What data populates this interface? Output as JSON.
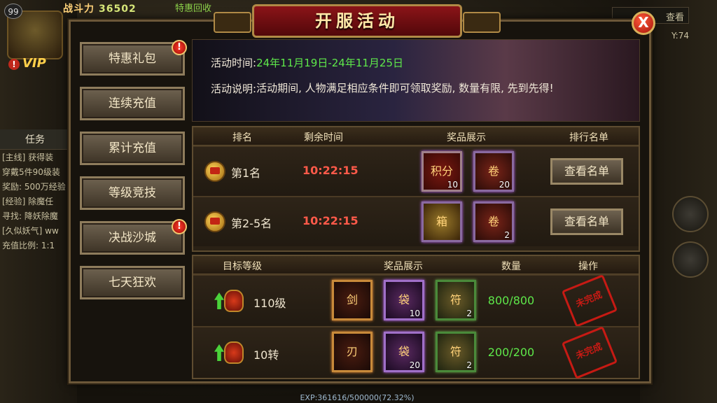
{
  "hud": {
    "level": "99",
    "power_label": "战斗力",
    "power_value": "36502",
    "power_extra": "特惠回收",
    "vip": "VIP",
    "alert_mark": "!",
    "map_title": "查看",
    "coord": "Y:74",
    "exp": "EXP:361616/500000(72.32%)",
    "quest": {
      "title": "任务",
      "lines": [
        "[主线] 获得装",
        "穿戴5件90级装",
        "奖励: 500万经验",
        "[经验] 除魔任",
        "寻找: 降妖除魔",
        "[久似妖气] ww",
        "充值比例: 1:1"
      ]
    }
  },
  "panel": {
    "title": "开服活动",
    "close_label": "X",
    "tabs": [
      {
        "label": "特惠礼包",
        "alert": "!"
      },
      {
        "label": "连续充值",
        "alert": ""
      },
      {
        "label": "累计充值",
        "alert": ""
      },
      {
        "label": "等级竞技",
        "alert": ""
      },
      {
        "label": "决战沙城",
        "alert": "!"
      },
      {
        "label": "七天狂欢",
        "alert": ""
      }
    ],
    "info": {
      "time_label": "活动时间:",
      "time_value": "24年11月19日-24年11月25日",
      "desc_label": "活动说明:",
      "desc_value": "活动期间, 人物满足相应条件即可领取奖励, 数量有限, 先到先得!"
    },
    "ranking": {
      "headers": {
        "rank": "排名",
        "time": "剩余时间",
        "rewards": "奖品展示",
        "list": "排行名单"
      },
      "rows": [
        {
          "name": "第1名",
          "time": "10:22:15",
          "items": [
            {
              "glyph": "积分",
              "count": "10"
            },
            {
              "glyph": "卷",
              "count": "20"
            }
          ],
          "button": "查看名单"
        },
        {
          "name": "第2-5名",
          "time": "10:22:15",
          "items": [
            {
              "glyph": "箱",
              "count": ""
            },
            {
              "glyph": "卷",
              "count": "2"
            }
          ],
          "button": "查看名单"
        }
      ]
    },
    "levels": {
      "headers": {
        "target": "目标等级",
        "rewards": "奖品展示",
        "qty": "数量",
        "op": "操作"
      },
      "rows": [
        {
          "target": "110级",
          "items": [
            {
              "glyph": "剑",
              "count": ""
            },
            {
              "glyph": "袋",
              "count": "10"
            },
            {
              "glyph": "符",
              "count": "2"
            }
          ],
          "qty": "800/800",
          "stamp": "未完成"
        },
        {
          "target": "10转",
          "items": [
            {
              "glyph": "刃",
              "count": ""
            },
            {
              "glyph": "袋",
              "count": "20"
            },
            {
              "glyph": "符",
              "count": "2"
            }
          ],
          "qty": "200/200",
          "stamp": "未完成"
        }
      ]
    }
  }
}
